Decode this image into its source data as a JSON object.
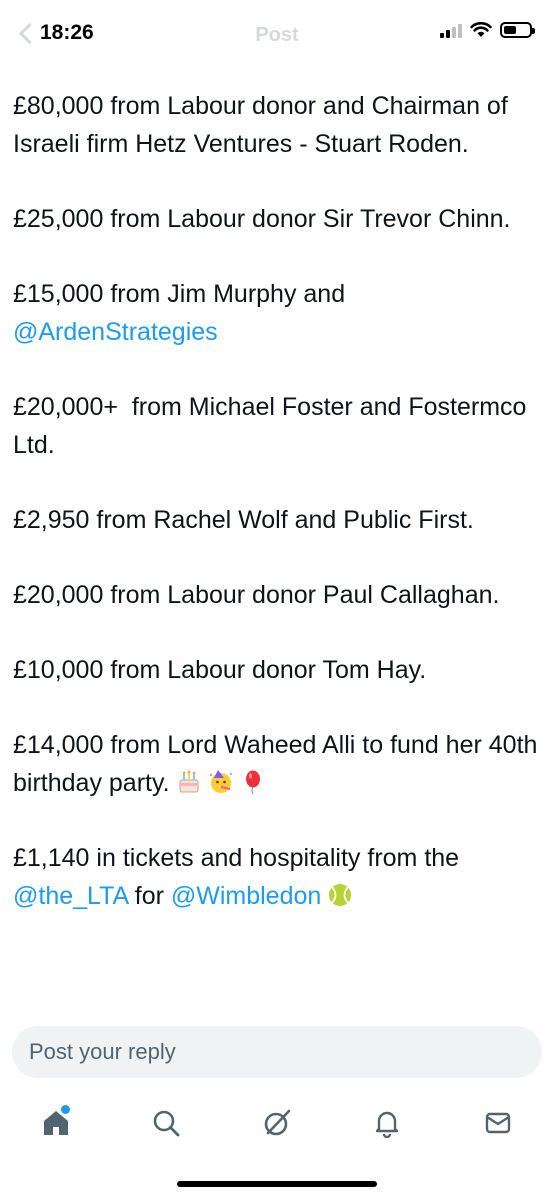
{
  "status_bar": {
    "time": "18:26",
    "header_title": "Post"
  },
  "paragraphs": [
    {
      "parts": [
        {
          "text": "£80,000 from Labour donor and Chairman of Israeli firm Hetz Ventures - Stuart Roden."
        }
      ]
    },
    {
      "parts": [
        {
          "text": "£25,000 from Labour donor Sir Trevor Chinn."
        }
      ]
    },
    {
      "parts": [
        {
          "text": "£15,000 from Jim Murphy and "
        },
        {
          "text": "@ArdenStrategies",
          "mention": true
        }
      ]
    },
    {
      "parts": [
        {
          "text": "£20,000+  from Michael Foster and Fostermco Ltd."
        }
      ]
    },
    {
      "parts": [
        {
          "text": "£2,950 from Rachel Wolf and Public First."
        }
      ]
    },
    {
      "parts": [
        {
          "text": "£20,000 from Labour donor Paul Callaghan."
        }
      ]
    },
    {
      "parts": [
        {
          "text": "£10,000 from Labour donor Tom Hay."
        }
      ]
    },
    {
      "parts": [
        {
          "text": "£14,000 from Lord Waheed Alli to fund her 40th birthday party."
        }
      ],
      "emojis": [
        "birthday-cake",
        "party-face",
        "balloon"
      ]
    },
    {
      "parts": [
        {
          "text": "£1,140 in tickets and hospitality from the "
        },
        {
          "text": "@the_LTA",
          "mention": true
        },
        {
          "text": " for "
        },
        {
          "text": "@Wimbledon",
          "mention": true
        }
      ],
      "emojis": [
        "tennis-ball"
      ]
    }
  ],
  "reply": {
    "placeholder": "Post your reply"
  },
  "nav": [
    {
      "name": "home",
      "icon": "home-icon",
      "active": true
    },
    {
      "name": "search",
      "icon": "search-icon"
    },
    {
      "name": "grok",
      "icon": "grok-icon"
    },
    {
      "name": "notifications",
      "icon": "bell-icon"
    },
    {
      "name": "messages",
      "icon": "mail-icon"
    }
  ],
  "colors": {
    "accent": "#1d9bf0",
    "text": "#0f1419",
    "muted": "#536471",
    "reply_bg": "#eff3f4"
  }
}
